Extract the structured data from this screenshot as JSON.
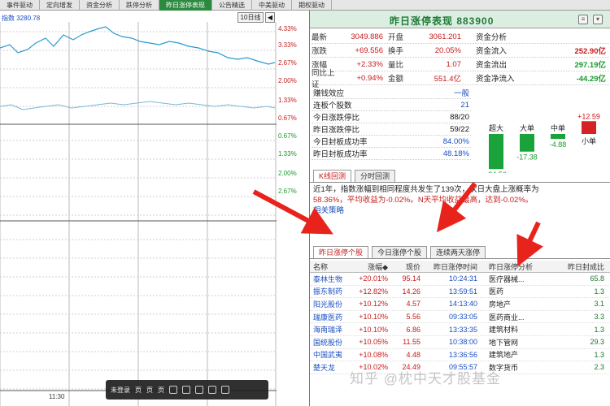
{
  "top_tabs": [
    {
      "label": "事件驱动",
      "active": false
    },
    {
      "label": "定向增发",
      "active": false
    },
    {
      "label": "资金分析",
      "active": false
    },
    {
      "label": "跌停分析",
      "active": false
    },
    {
      "label": "昨日涨停表现",
      "active": true
    },
    {
      "label": "公告精选",
      "active": false
    },
    {
      "label": "中美驱动",
      "active": false
    },
    {
      "label": "期权驱动",
      "active": false
    }
  ],
  "chart": {
    "index_label": "指数  3280.78",
    "period_label": "10日线",
    "arrow_glyph": "◀",
    "time_label": "11:30",
    "pct_up": [
      "4.33%",
      "3.33%",
      "2.67%",
      "2.00%",
      "1.33%",
      "0.67%"
    ],
    "pct_down": [
      "0.67%",
      "1.33%",
      "2.00%",
      "2.67%"
    ],
    "up_color": "#c61b1b",
    "down_color": "#1a9a2c",
    "line_color": "#2a9ad0"
  },
  "video_bar": {
    "items": [
      "未登录",
      "页",
      "页",
      "页"
    ]
  },
  "title": {
    "text": "昨日涨停表现 883900"
  },
  "quote": [
    {
      "l1": "最新",
      "v1": "3049.886",
      "l2": "开盘",
      "v2": "3061.201"
    },
    {
      "l1": "涨跌",
      "v1": "+69.556",
      "l2": "换手",
      "v2": "20.05%"
    },
    {
      "l1": "涨幅",
      "v1": "+2.33%",
      "l2": "量比",
      "v2": "1.07"
    },
    {
      "l1": "同比上证",
      "v1": "+0.94%",
      "l2": "金额",
      "v2": "551.4亿"
    }
  ],
  "funds": [
    {
      "label": "资金分析",
      "value": ""
    },
    {
      "label": "资金流入",
      "value": "252.90亿"
    },
    {
      "label": "资金流出",
      "value": "297.19亿"
    },
    {
      "label": "资金净流入",
      "value": "-44.29亿"
    }
  ],
  "stats": [
    {
      "label": "赚钱效应",
      "value": "一般"
    },
    {
      "label": "连板个股数",
      "value": "21"
    },
    {
      "label": "今日涨跌停比",
      "value": "88/20"
    },
    {
      "label": "昨日涨跌停比",
      "value": "59/22"
    },
    {
      "label": "今日封板成功率",
      "value": "84.00%"
    },
    {
      "label": "昨日封板成功率",
      "value": "48.18%"
    }
  ],
  "flow_bars": [
    {
      "label": "超大",
      "value": "-34.56"
    },
    {
      "label": "大单",
      "value": "-17.38"
    },
    {
      "label": "中单",
      "value": "-4.88"
    },
    {
      "label": "小单",
      "value": "+12.59"
    }
  ],
  "subtabs1": [
    {
      "label": "K线回测",
      "active": true
    },
    {
      "label": "分时回测",
      "active": false
    }
  ],
  "desc": {
    "line1": "近1年，指数涨幅到相同程度共发生了139次，次日大盘上涨概率为",
    "line2": "58.36%，平均收益为-0.02%。N天平均收益最高，达到-0.02%。",
    "link": "相关策略"
  },
  "subtabs2": [
    {
      "label": "昨日涨停个股",
      "active": true
    },
    {
      "label": "今日涨停个股",
      "active": false
    },
    {
      "label": "连续两天涨停",
      "active": false
    }
  ],
  "table": {
    "headers": [
      "名称",
      "涨幅◆",
      "现价",
      "昨日涨停时间",
      "昨日涨停分析",
      "昨日封成比"
    ],
    "rows": [
      {
        "name": "泰林生物",
        "chg": "+20.01%",
        "price": "95.14",
        "time": "10:24:31",
        "ind": "医疗器械...",
        "rate": "65.8"
      },
      {
        "name": "振东制药",
        "chg": "+12.82%",
        "price": "14.26",
        "time": "13:59:51",
        "ind": "医药",
        "rate": "1.3"
      },
      {
        "name": "阳光股份",
        "chg": "+10.12%",
        "price": "4.57",
        "time": "14:13:40",
        "ind": "房地产",
        "rate": "3.1"
      },
      {
        "name": "瑞康医药",
        "chg": "+10.10%",
        "price": "5.56",
        "time": "09:33:05",
        "ind": "医药商业...",
        "rate": "3.3"
      },
      {
        "name": "海南瑞泽",
        "chg": "+10.10%",
        "price": "6.86",
        "time": "13:33:35",
        "ind": "建筑材料",
        "rate": "1.3"
      },
      {
        "name": "国统股份",
        "chg": "+10.05%",
        "price": "11.55",
        "time": "10:38:00",
        "ind": "地下管网",
        "rate": "29.3"
      },
      {
        "name": "中国武夷",
        "chg": "+10.08%",
        "price": "4.48",
        "time": "13:36:56",
        "ind": "建筑地产",
        "rate": "1.3"
      },
      {
        "name": "楚天龙",
        "chg": "+10.02%",
        "price": "24.49",
        "time": "09:55:57",
        "ind": "数字货币",
        "rate": "2.3"
      }
    ]
  },
  "watermark": "知乎 @枕中天才股基金"
}
